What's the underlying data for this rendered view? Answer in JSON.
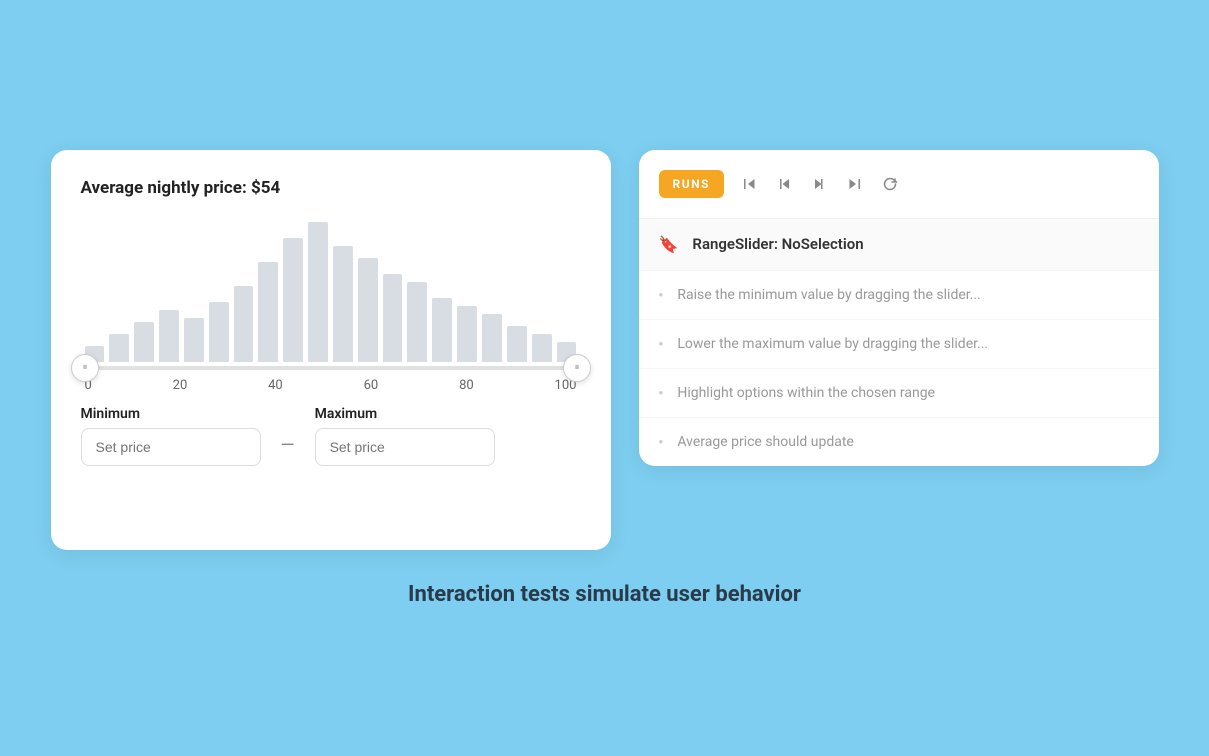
{
  "left_panel": {
    "price_label": "Average nightly price: ",
    "price_value": "$54",
    "chart": {
      "bars": [
        8,
        14,
        20,
        26,
        22,
        30,
        38,
        50,
        62,
        70,
        58,
        52,
        44,
        40,
        32,
        28,
        24,
        18,
        14,
        10
      ],
      "x_labels": [
        "0",
        "20",
        "40",
        "60",
        "80",
        "100"
      ]
    },
    "minimum_label": "Minimum",
    "maximum_label": "Maximum",
    "min_placeholder": "Set price",
    "max_placeholder": "Set price",
    "dash": "—"
  },
  "right_panel": {
    "runs_badge": "RUNS",
    "toolbar_buttons": [
      "skip-back",
      "prev",
      "next",
      "skip-forward",
      "refresh"
    ],
    "test_title": "RangeSlider: NoSelection",
    "test_items": [
      {
        "text": "Raise the minimum value by dragging the slider...",
        "type": "dot"
      },
      {
        "text": "Lower the maximum value by dragging the slider...",
        "type": "dot"
      },
      {
        "text": "Highlight options within the chosen range",
        "type": "dot"
      },
      {
        "text": "Average price should update",
        "type": "dot"
      }
    ]
  },
  "bottom_title": "Interaction tests simulate user behavior"
}
